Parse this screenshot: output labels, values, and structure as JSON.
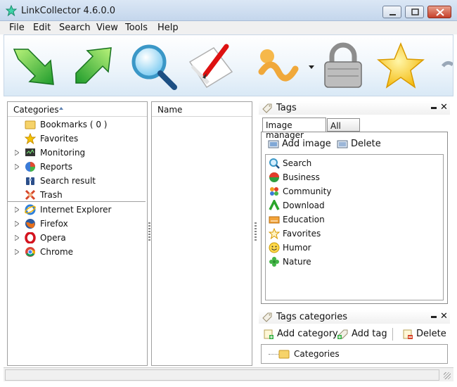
{
  "window": {
    "title": "LinkCollector 4.6.0.0"
  },
  "menu": [
    "File",
    "Edit",
    "Search",
    "View",
    "Tools",
    "Help"
  ],
  "toolbar": {
    "buttons": [
      "down-arrow-icon",
      "up-arrow-icon",
      "magnifier-icon",
      "paper-pen-icon",
      "bulb-icon",
      "padlock-icon",
      "star-icon"
    ]
  },
  "categories": {
    "header": "Categories",
    "items": [
      {
        "label": "Bookmarks ( 0 )",
        "icon": "folder-icon",
        "expandable": false
      },
      {
        "label": "Favorites",
        "icon": "star-icon",
        "expandable": false
      },
      {
        "label": "Monitoring",
        "icon": "monitor-icon",
        "expandable": true
      },
      {
        "label": "Reports",
        "icon": "pie-chart-icon",
        "expandable": true
      },
      {
        "label": "Search result",
        "icon": "binoculars-icon",
        "expandable": false
      },
      {
        "label": "Trash",
        "icon": "trash-icon",
        "expandable": false
      }
    ],
    "browsers": [
      {
        "label": "Internet Explorer",
        "icon": "ie-icon"
      },
      {
        "label": "Firefox",
        "icon": "firefox-icon"
      },
      {
        "label": "Opera",
        "icon": "opera-icon"
      },
      {
        "label": "Chrome",
        "icon": "chrome-icon"
      }
    ]
  },
  "list": {
    "header": "Name"
  },
  "tags": {
    "title": "Tags",
    "tabs": [
      "Image manager",
      "All tags"
    ],
    "add_image": "Add image",
    "delete": "Delete",
    "items": [
      "Search",
      "Business",
      "Community",
      "Download",
      "Education",
      "Favorites",
      "Humor",
      "Nature"
    ]
  },
  "tag_categories": {
    "title": "Tags categories",
    "add_category": "Add category",
    "add_tag": "Add tag",
    "delete": "Delete",
    "root": "Categories"
  },
  "colors": {
    "accent": "#3a7bd5",
    "titlebar": "#c4d6ec"
  }
}
